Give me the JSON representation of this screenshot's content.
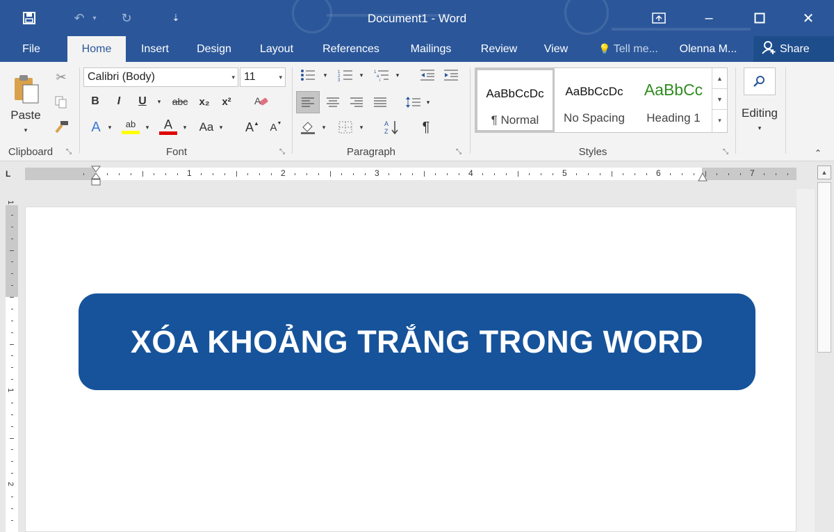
{
  "window": {
    "title": "Document1 - Word",
    "controls": {
      "minimize": "–",
      "maximize": "☐",
      "close": "✕"
    }
  },
  "quick_access": {
    "save": "💾",
    "undo": "↶",
    "redo": "↻",
    "customize": "⇣"
  },
  "tabs": [
    "File",
    "Home",
    "Insert",
    "Design",
    "Layout",
    "References",
    "Mailings",
    "Review",
    "View"
  ],
  "active_tab": "Home",
  "tell_me": "Tell me...",
  "user": "Olenna M...",
  "share": "Share",
  "clipboard": {
    "paste_label": "Paste",
    "group_label": "Clipboard"
  },
  "font": {
    "name": "Calibri (Body)",
    "size": "11",
    "group_label": "Font",
    "bold": "B",
    "italic": "I",
    "underline": "U",
    "strikethrough": "abc",
    "subscript": "x₂",
    "superscript": "x²",
    "grow": "A",
    "shrink": "A",
    "change_case": "Aa",
    "highlight_color": "#ffff00",
    "font_color": "#e00000"
  },
  "paragraph": {
    "group_label": "Paragraph",
    "show_marks": "¶"
  },
  "styles": {
    "group_label": "Styles",
    "items": [
      {
        "sample": "AaBbCcDc",
        "name": "¶ Normal",
        "sample_color": "#111111"
      },
      {
        "sample": "AaBbCcDc",
        "name": "No Spacing",
        "sample_color": "#111111"
      },
      {
        "sample": "AaBbCc",
        "name": "Heading 1",
        "sample_color": "#2e8b1e"
      }
    ]
  },
  "editing": {
    "label": "Editing"
  },
  "ruler": {
    "tab_selector": "L",
    "numbers": [
      "1",
      "2",
      "3",
      "4",
      "5",
      "6",
      "7"
    ],
    "vertical_numbers": [
      "1",
      "1",
      "2"
    ]
  },
  "document": {
    "banner_text": "XÓA KHOẢNG TRẮNG TRONG WORD",
    "banner_color": "#16539b"
  },
  "colors": {
    "word_blue": "#2b579a",
    "ribbon": "#f3f3f3"
  }
}
